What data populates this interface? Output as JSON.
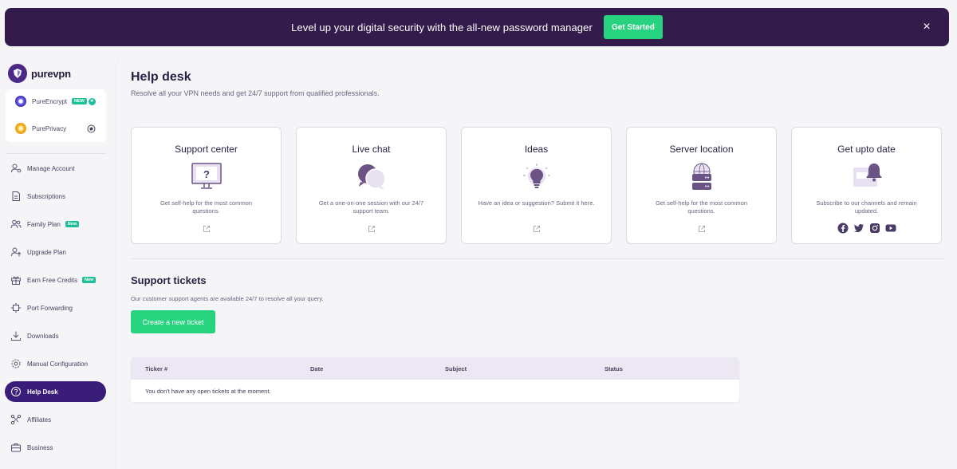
{
  "banner": {
    "text": "Level up your digital security with the all-new password manager",
    "button_label": "Get Started",
    "close_icon": "×"
  },
  "sidebar": {
    "logo_text": "purevpn",
    "products": [
      {
        "label": "PureEncrypt",
        "badge": "NEW"
      },
      {
        "label": "PurePrivacy"
      }
    ],
    "nav": [
      {
        "label": "Manage Account",
        "icon": "user-gear-icon"
      },
      {
        "label": "Subscriptions",
        "icon": "document-icon"
      },
      {
        "label": "Family Plan",
        "icon": "users-icon",
        "badge": "New"
      },
      {
        "label": "Upgrade Plan",
        "icon": "user-upgrade-icon"
      },
      {
        "label": "Earn Free Credits",
        "icon": "gift-icon",
        "badge": "New"
      },
      {
        "label": "Port Forwarding",
        "icon": "port-icon"
      },
      {
        "label": "Downloads",
        "icon": "download-icon"
      },
      {
        "label": "Manual Configuration",
        "icon": "gear-icon"
      },
      {
        "label": "Help Desk",
        "icon": "question-icon",
        "active": true
      },
      {
        "label": "Affiliates",
        "icon": "affiliates-icon"
      },
      {
        "label": "Business",
        "icon": "briefcase-icon"
      }
    ]
  },
  "main": {
    "title": "Help desk",
    "subtitle": "Resolve all your VPN needs and get 24/7 support from qualified professionals.",
    "cards": [
      {
        "title": "Support center",
        "desc": "Get self-help for the most common questions."
      },
      {
        "title": "Live chat",
        "desc": "Get a one-on-one session with our 24/7 support team."
      },
      {
        "title": "Ideas",
        "desc": "Have an idea or suggestion? Submit it here."
      },
      {
        "title": "Server location",
        "desc": "Get self-help for the most common questions."
      },
      {
        "title": "Get upto date",
        "desc": "Subscribe to our channels and remain updated."
      }
    ],
    "tickets": {
      "title": "Support tickets",
      "subtitle": "Our customer support agents are available 24/7 to resolve all your query.",
      "button_label": "Create a new ticket",
      "columns": [
        "Ticker #",
        "Date",
        "Subject",
        "Status"
      ],
      "empty_text": "You don't have any open tickets at the moment."
    }
  },
  "colors": {
    "banner_bg": "#331b4b",
    "accent_green": "#27d37e",
    "active_nav": "#3a1d78",
    "icon_purple": "#6b5485"
  }
}
